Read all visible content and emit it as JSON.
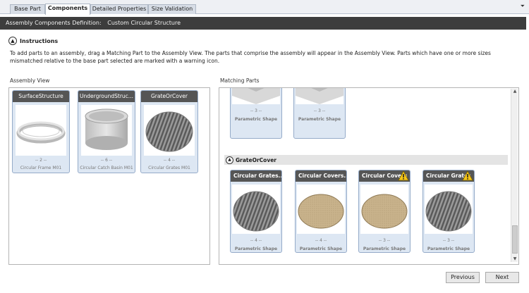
{
  "tabs": [
    {
      "label": "Base Part"
    },
    {
      "label": "Components"
    },
    {
      "label": "Detailed Properties"
    },
    {
      "label": "Size Validation"
    }
  ],
  "definition": {
    "label": "Assembly Components Definition:",
    "value": "Custom Circular Structure"
  },
  "instructions": {
    "title": "Instructions",
    "text": "To add parts to an assembly, drag a Matching Part to the Assembly View. The parts that comprise the assembly will appear in the Assembly View. Parts which have one or more sizes mismatched relative to the base part selected are marked with a warning icon."
  },
  "assembly_view": {
    "label": "Assembly View",
    "cards": [
      {
        "title": "SurfaceStructure",
        "count": "-- 2 --",
        "name": "Circular Frame M01",
        "icon": "frame-ring"
      },
      {
        "title": "UndergroundStruc...",
        "count": "-- 6 --",
        "name": "Circular Catch Basin M01",
        "icon": "basin-cylinder"
      },
      {
        "title": "GrateOrCover",
        "count": "-- 4 --",
        "name": "Circular Grates M01",
        "icon": "striped-grate"
      }
    ]
  },
  "matching_parts": {
    "label": "Matching Parts",
    "top_cards": [
      {
        "count": "-- 3 --",
        "name": "Parametric Shape"
      },
      {
        "count": "-- 3 --",
        "name": "Parametric Shape"
      }
    ],
    "group_title": "GrateOrCover",
    "cards": [
      {
        "title": "Circular Grates...",
        "count": "-- 4 --",
        "name": "Parametric Shape",
        "warning": false,
        "icon": "striped-grate"
      },
      {
        "title": "Circular Covers...",
        "count": "-- 4 --",
        "name": "Parametric Shape",
        "warning": false,
        "icon": "solid-cover"
      },
      {
        "title": "Circular Covers",
        "count": "-- 3 --",
        "name": "Parametric Shape",
        "warning": true,
        "icon": "solid-cover"
      },
      {
        "title": "Circular Grates",
        "count": "-- 3 --",
        "name": "Parametric Shape",
        "warning": true,
        "icon": "striped-grate"
      }
    ]
  },
  "buttons": {
    "previous": "Previous",
    "next": "Next"
  },
  "colors": {
    "header_dark": "#3d3d3d",
    "card_bg": "#dde7f3",
    "card_border": "#95abc9",
    "warning": "#f5c518"
  }
}
